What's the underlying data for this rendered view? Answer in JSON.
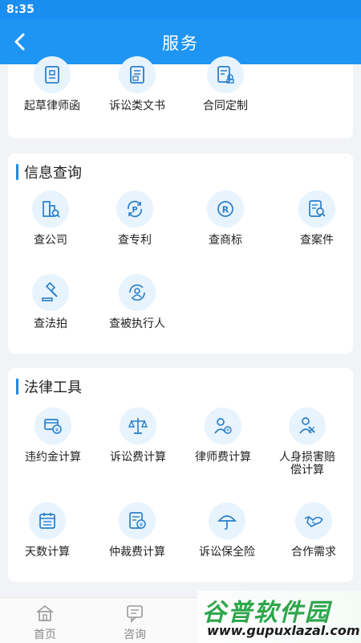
{
  "status_bar": {
    "time": "8:35"
  },
  "header": {
    "title": "服务"
  },
  "top_section": {
    "items": [
      {
        "label": "起草律师函",
        "icon": "document-stamp-icon"
      },
      {
        "label": "诉讼类文书",
        "icon": "litigation-document-icon"
      },
      {
        "label": "合同定制",
        "icon": "contract-stamp-icon"
      }
    ]
  },
  "info_section": {
    "title": "信息查询",
    "items": [
      {
        "label": "查公司",
        "icon": "building-search-icon"
      },
      {
        "label": "查专利",
        "icon": "patent-icon"
      },
      {
        "label": "查商标",
        "icon": "trademark-icon"
      },
      {
        "label": "查案件",
        "icon": "case-search-icon"
      },
      {
        "label": "查法拍",
        "icon": "gavel-icon"
      },
      {
        "label": "查被执行人",
        "icon": "person-refresh-icon"
      }
    ]
  },
  "tools_section": {
    "title": "法律工具",
    "items": [
      {
        "label": "违约金计算",
        "icon": "card-yen-icon"
      },
      {
        "label": "诉讼费计算",
        "icon": "scales-icon"
      },
      {
        "label": "律师费计算",
        "icon": "lawyer-fee-icon"
      },
      {
        "label": "人身损害赔偿计算",
        "line1": "人身损害赔",
        "line2": "偿计算",
        "icon": "injured-person-icon"
      },
      {
        "label": "天数计算",
        "icon": "calendar-icon"
      },
      {
        "label": "仲裁费计算",
        "icon": "arbitration-fee-icon"
      },
      {
        "label": "诉讼保全险",
        "icon": "umbrella-icon"
      },
      {
        "label": "合作需求",
        "icon": "handshake-icon"
      }
    ]
  },
  "bottom_nav": {
    "items": [
      {
        "label": "首页",
        "icon": "home-icon"
      },
      {
        "label": "咨询",
        "icon": "chat-icon"
      }
    ]
  },
  "watermark": {
    "main": "谷普软件园",
    "url": "www.gupuxlazal.com"
  },
  "colors": {
    "primary": "#1e95f3",
    "icon_bg": "#e7f3fd",
    "icon_stroke": "#2a7fc9",
    "watermark_green": "#2ea64b"
  }
}
